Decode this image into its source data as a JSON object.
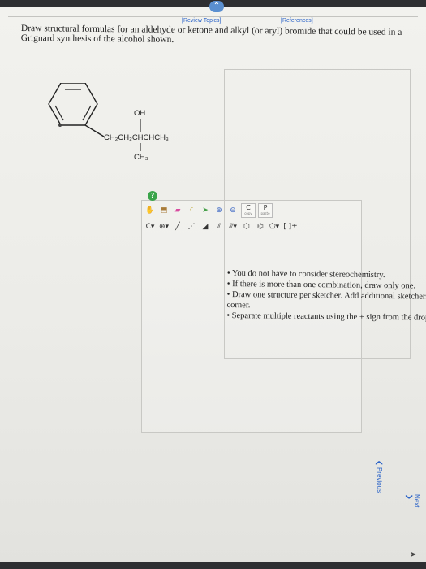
{
  "header": {
    "review_topics": "[Review Topics]",
    "references": "[References]"
  },
  "question": {
    "text": "Draw structural formulas for an aldehyde or ketone and alkyl (or aryl) bromide that could be used in a Grignard synthesis of the alcohol shown."
  },
  "molecule": {
    "oh": "OH",
    "chain": "CH₂CH₂CHCHCH₃",
    "ch3": "CH₃"
  },
  "notes": [
    "You do not have to consider stereochemistry.",
    "If there is more than one combination, draw only one.",
    "Draw one structure per sketcher. Add additional sketchers using the drop-down menu in the bottom right corner.",
    "Separate multiple reactants using the + sign from the drop-down menu."
  ],
  "sketcher": {
    "tool_c_label": "C",
    "tool_c_sub": "copy",
    "tool_p_label": "P",
    "tool_p_sub": "paste",
    "charge_label": "[ ]±"
  },
  "navigation": {
    "previous": "Previous",
    "next": "Next"
  },
  "colors": {
    "link": "#2c64c8",
    "green_button": "#3aa44a",
    "collapse_button": "#5a8fd0"
  }
}
